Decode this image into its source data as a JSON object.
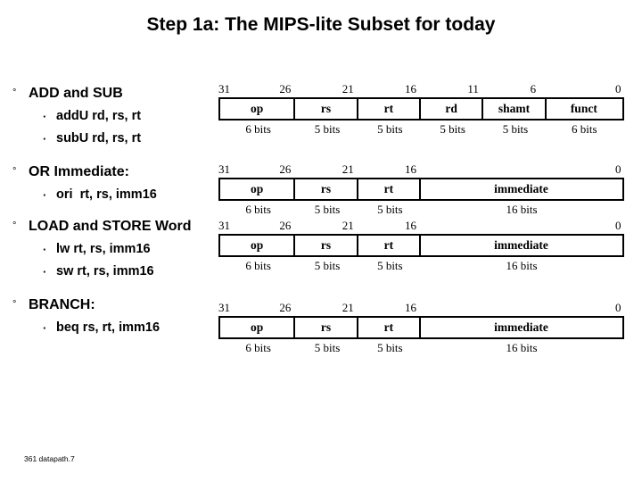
{
  "slide": {
    "title": "Step 1a: The MIPS-lite Subset for today",
    "footer": "361 datapath.7"
  },
  "markers": {
    "level1": "°",
    "level2": "·"
  },
  "bullets": [
    {
      "heading": "ADD and SUB",
      "items": [
        "addU rd, rs, rt",
        "subU rd, rs, rt"
      ]
    },
    {
      "heading": "OR Immediate:",
      "items": [
        "ori  rt, rs, imm16"
      ]
    },
    {
      "heading": "LOAD and STORE Word",
      "items": [
        "lw rt, rs, imm16",
        "sw rt, rs, imm16"
      ]
    },
    {
      "heading": "BRANCH:",
      "items": [
        "beq rs, rt, imm16"
      ]
    }
  ],
  "formats": [
    {
      "name": "r-type",
      "bit_labels": [
        "31",
        "26",
        "21",
        "16",
        "11",
        "6",
        "0"
      ],
      "fields": [
        "op",
        "rs",
        "rt",
        "rd",
        "shamt",
        "funct"
      ],
      "widths": [
        "6 bits",
        "5 bits",
        "5 bits",
        "5 bits",
        "5 bits",
        "6 bits"
      ],
      "spans": [
        6,
        5,
        5,
        5,
        5,
        6
      ]
    },
    {
      "name": "i-type-ori",
      "bit_labels": [
        "31",
        "26",
        "21",
        "16",
        "0"
      ],
      "fields": [
        "op",
        "rs",
        "rt",
        "immediate"
      ],
      "widths": [
        "6 bits",
        "5 bits",
        "5 bits",
        "16 bits"
      ],
      "spans": [
        6,
        5,
        5,
        16
      ]
    },
    {
      "name": "i-type-loadstore",
      "bit_labels": [
        "31",
        "26",
        "21",
        "16",
        "0"
      ],
      "fields": [
        "op",
        "rs",
        "rt",
        "immediate"
      ],
      "widths": [
        "6 bits",
        "5 bits",
        "5 bits",
        "16 bits"
      ],
      "spans": [
        6,
        5,
        5,
        16
      ]
    },
    {
      "name": "i-type-branch",
      "bit_labels": [
        "31",
        "26",
        "21",
        "16",
        "0"
      ],
      "fields": [
        "op",
        "rs",
        "rt",
        "immediate"
      ],
      "widths": [
        "6 bits",
        "5 bits",
        "5 bits",
        "16 bits"
      ],
      "spans": [
        6,
        5,
        5,
        16
      ]
    }
  ]
}
